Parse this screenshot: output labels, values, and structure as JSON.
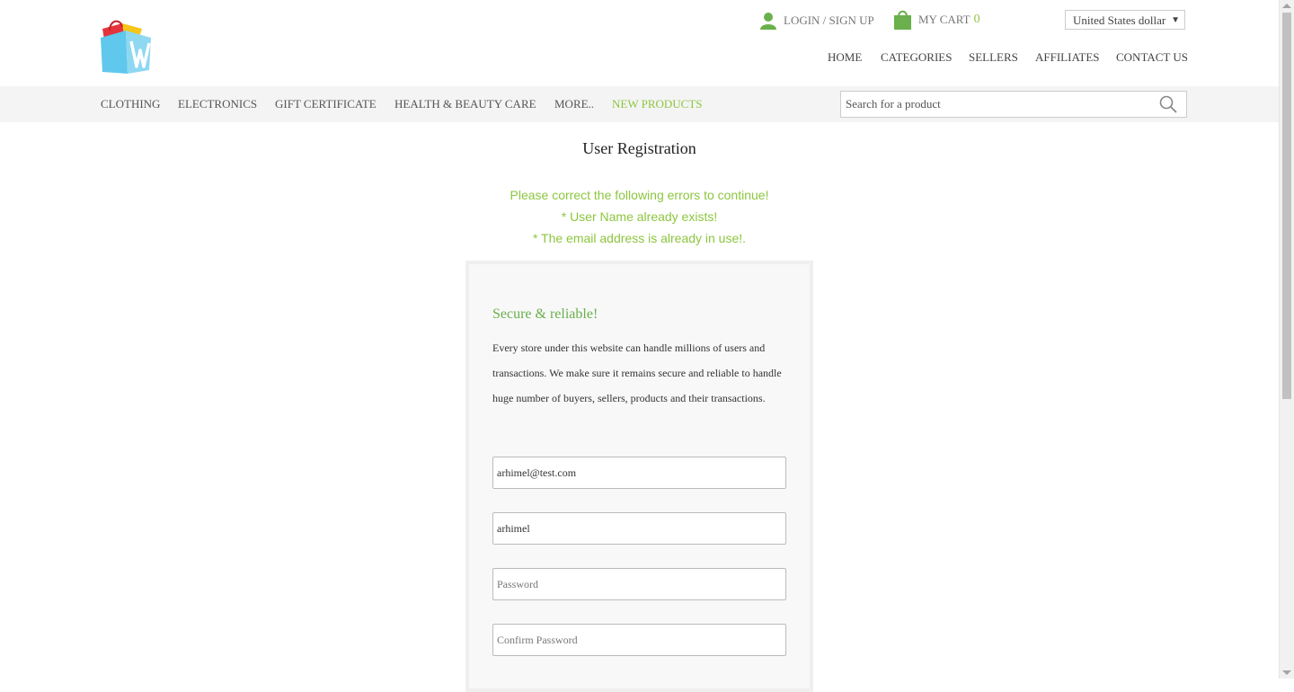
{
  "header": {
    "login_label": "LOGIN / SIGN UP",
    "cart_label": "MY CART",
    "cart_count": "0",
    "currency": "United States dollar",
    "nav": [
      "HOME",
      "CATEGORIES",
      "SELLERS",
      "AFFILIATES",
      "CONTACT US"
    ]
  },
  "categories": [
    "CLOTHING",
    "ELECTRONICS",
    "GIFT CERTIFICATE",
    "HEALTH & BEAUTY CARE",
    "MORE..",
    "NEW PRODUCTS"
  ],
  "search": {
    "placeholder": "Search for a product",
    "icon": "search-icon"
  },
  "page": {
    "title": "User Registration",
    "errors": [
      "Please correct the following errors to continue!",
      "* User Name already exists!",
      "* The email address is already in use!."
    ]
  },
  "card": {
    "heading": "Secure & reliable!",
    "text": "Every store under this website can handle millions of users and transactions. We make sure it remains secure and reliable to handle huge number of buyers, sellers, products and their transactions."
  },
  "form": {
    "email_value": "arhimel@test.com",
    "username_value": "arhimel",
    "password_placeholder": "Password",
    "confirm_placeholder": "Confirm Password"
  },
  "colors": {
    "accent": "#8cc63f",
    "heading_green": "#6ab04c",
    "catbar_bg": "#f4f4f4"
  }
}
